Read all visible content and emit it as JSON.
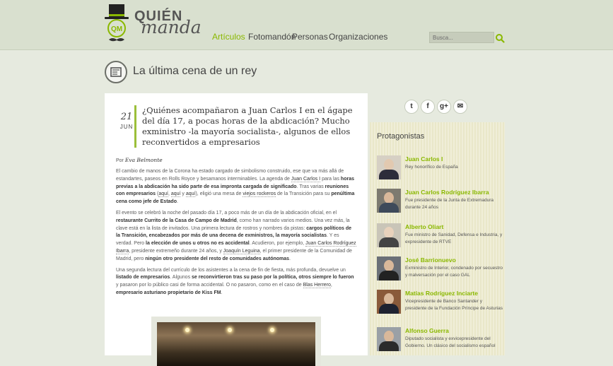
{
  "site": {
    "logo_top": "QUIÉN",
    "logo_bottom": "manda"
  },
  "nav": {
    "items": [
      "Artículos",
      "Fotomandón",
      "Personas",
      "Organizaciones"
    ],
    "active": "Artículos"
  },
  "search": {
    "placeholder": "Busca..."
  },
  "section": {
    "title": "La última cena de un rey"
  },
  "article": {
    "day": "21",
    "month": "JUN",
    "title": "¿Quiénes acompañaron a Juan Carlos I en el ágape del día 17, a pocas horas de la abdicación? Mucho exministro -la mayoría socialista-, algunos de ellos reconvertidos a empresarios",
    "by_prefix": "Por",
    "author": "Eva Belmonte",
    "p1": {
      "a": "El cambio de manos de la Corona ha estado cargado de simbolismo construido, ese que va más allá de estandartes, paseos en Rolls Royce y besamanos interminables. La agenda de ",
      "l1": "Juan Carlos I",
      "b": " para las ",
      "s1": "horas previas a la abdicación ha sido parte de esa impronta cargada de significado",
      "c": ". Tras varias ",
      "s2": "reuniones con empresarios",
      "d": " (",
      "l2": "aquí",
      "e": ", ",
      "l3": "aquí",
      "f": " y ",
      "l4": "aquí",
      "g": "), eligió una mesa de ",
      "l5": "viejos rockeros",
      "h": " de la Transición para su ",
      "s3": "penúltima cena como jefe de Estado",
      "i": "."
    },
    "p2": {
      "a": "El evento se celebró la noche del pasado día 17, a poco más de un día de la abdicación oficial, en el ",
      "s1": "restaurante Currito de la Casa de Campo de Madrid",
      "b": ", como han narrado varios medios. Una vez más, la clave está en la lista de invitados. Una primera lectura de rostros y nombres da pistas: ",
      "s2": "cargos políticos de la Transición, encabezados por más de una decena de exministros, la mayoría socialistas",
      "c": ". Y es verdad. Pero ",
      "s3": "la elección de unos u otros no es accidental",
      "d": ". Acudieron, por ejemplo, ",
      "l1": "Juan Carlos Rodríguez Ibarra",
      "e": ", presidente extremeño durante 24 años, y ",
      "l2": "Joaquín Leguina",
      "f": ", el primer presidente de la Comunidad de Madrid, pero ",
      "s4": "ningún otro presidente del resto de comunidades autónomas",
      "g": "."
    },
    "p3": {
      "a": "Una segunda lectura del currículo de los asistentes a la cena de fin de fiesta, más profunda, devuelve un ",
      "s1": "listado de empresarios",
      "b": ". Algunos ",
      "s2": "se reconvirtieron tras su paso por la política, otros siempre lo fueron",
      "c": " y pasaron por lo público casi de forma accidental. O no pasaron, como en el caso de ",
      "l1": "Blas Herrero",
      "d": ", ",
      "s3": "empresario asturiano propietario de Kiss FM",
      "e": "."
    }
  },
  "social": {
    "icons": [
      "twitter-icon",
      "facebook-icon",
      "googleplus-icon",
      "share-icon"
    ],
    "labels": [
      "t",
      "f",
      "g+",
      "✉"
    ]
  },
  "sidebar": {
    "title": "Protagonistas",
    "people": [
      {
        "name": "Juan Carlos I",
        "desc": "Rey honorífico de España"
      },
      {
        "name": "Juan Carlos Rodríguez Ibarra",
        "desc": "Fue presidente de la Junta de Extremadura durante 24 años"
      },
      {
        "name": "Alberto Oliart",
        "desc": "Fue ministro de Sanidad, Defensa e Industria, y expresidente de RTVE"
      },
      {
        "name": "José Barrionuevo",
        "desc": "Exministro de Interior, condenado por secuestro y malversación por el caso GAL"
      },
      {
        "name": "Matías Rodríguez Inciarte",
        "desc": "Vicepresidente de Banco Santander y presidente de la Fundación Príncipe de Asturias"
      },
      {
        "name": "Alfonso Guerra",
        "desc": "Diputado socialista y exvicepresidente del Gobierno. Un clásico del socialismo español"
      }
    ]
  },
  "colors": {
    "accent": "#8ab800",
    "background": "#e6eadf",
    "header": "#d9e0cf"
  }
}
